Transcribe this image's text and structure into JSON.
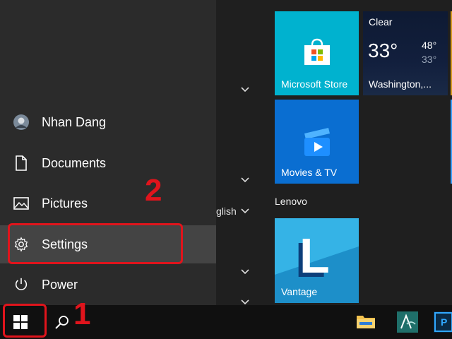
{
  "start_menu": {
    "left_pane": {
      "items": [
        {
          "label": "Nhan Dang",
          "icon": "user-avatar-icon"
        },
        {
          "label": "Documents",
          "icon": "document-icon"
        },
        {
          "label": "Pictures",
          "icon": "pictures-icon"
        },
        {
          "label": "Settings",
          "icon": "gear-icon"
        },
        {
          "label": "Power",
          "icon": "power-icon"
        }
      ]
    },
    "app_list": {
      "partial_text": "glish",
      "chevrons": [
        "chevron-down-icon",
        "chevron-down-icon",
        "chevron-down-icon",
        "chevron-down-icon",
        "chevron-down-icon"
      ]
    },
    "tiles": {
      "store": {
        "label": "Microsoft Store"
      },
      "weather": {
        "condition": "Clear",
        "temp": "33°",
        "high": "48°",
        "low": "33°",
        "location": "Washington,..."
      },
      "movies": {
        "label": "Movies & TV"
      },
      "group_name": "Lenovo",
      "vantage": {
        "label": "Vantage",
        "logo_letter": "L"
      }
    }
  },
  "annotations": {
    "step1": "1",
    "step2": "2"
  },
  "colors": {
    "accent_red": "#e0141c",
    "store_tile": "#00b2cf",
    "movies_tile": "#0a6ed1",
    "vantage_tile": "#2aa3d9"
  }
}
